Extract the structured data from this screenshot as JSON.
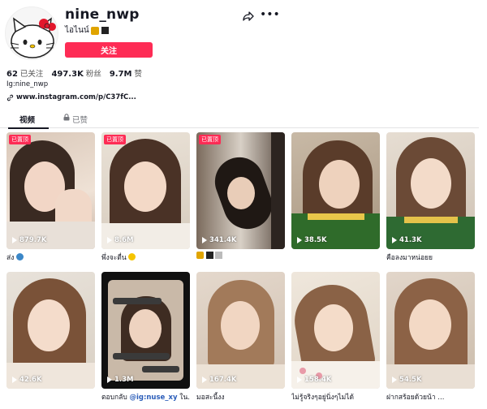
{
  "profile": {
    "username": "nine_nwp",
    "subtitle": "ไอไนน์",
    "follow_label": "关注",
    "stats": [
      {
        "value": "62",
        "label": "已关注"
      },
      {
        "value": "497.3K",
        "label": "粉丝"
      },
      {
        "value": "9.7M",
        "label": "赞"
      }
    ],
    "bio": "Ig:nine_nwp",
    "link": "www.instagram.com/p/C37fC..."
  },
  "tabs": {
    "videos": "视频",
    "liked": "已赞"
  },
  "pinned_label": "已置顶",
  "videos": [
    {
      "views": "879.7K",
      "caption": "ส่ง",
      "pinned": true
    },
    {
      "views": "8.6M",
      "caption": "พึ่งจะตื่น",
      "pinned": true
    },
    {
      "views": "341.4K",
      "caption": "",
      "pinned": true
    },
    {
      "views": "38.5K",
      "caption": "",
      "pinned": false
    },
    {
      "views": "41.3K",
      "caption": "คือลงมาหน่อยย",
      "pinned": false
    },
    {
      "views": "42.6K",
      "caption": "",
      "pinned": false
    },
    {
      "views": "1.3M",
      "caption_prefix": "ตอบกลับ ",
      "caption_mention": "@ig:nuse_xy",
      "caption_suffix": " ใน...",
      "pinned": false
    },
    {
      "views": "167.4K",
      "caption": "มอสะนี้งง",
      "pinned": false
    },
    {
      "views": "158.4K",
      "caption": "ไม่รู้จริงๆอยู่นิ่งๆไม่ได้",
      "pinned": false
    },
    {
      "views": "54.5K",
      "caption": "ฝากสร้อยด้วยน้า ...",
      "pinned": false
    }
  ],
  "colors": {
    "accent": "#fe2c55",
    "text": "#161823",
    "muted": "#73757b"
  }
}
